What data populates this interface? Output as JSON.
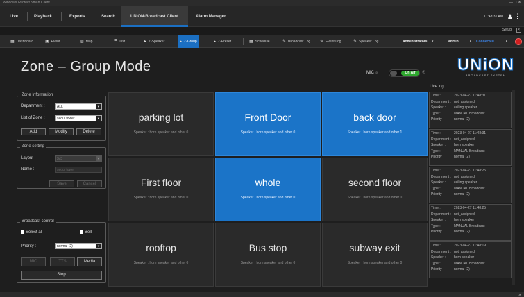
{
  "window": {
    "title": "Windows IProtect Smart Client",
    "controls": "—  □  ✕"
  },
  "menu": {
    "items": [
      "Live",
      "Playback",
      "Exports",
      "Search",
      "UNION-Broadcast Client",
      "Alarm Manager"
    ],
    "clock": "11:48:31 AM",
    "setup": "Setup"
  },
  "toolbar": {
    "items": [
      "Dashboard",
      "Event",
      "Map",
      "List",
      "Z-Speaker",
      "Z-Group",
      "Z-Preset",
      "Schedule",
      "Broadcast Log",
      "Event Log",
      "Speaker Log"
    ],
    "user_role": "Administrators",
    "user_name": "admin",
    "status": "Connected",
    "sep": "/"
  },
  "page": {
    "title": "Zone – Group Mode",
    "mic_label": "MIC",
    "mic_sub": "⊘",
    "on_air": "On Air"
  },
  "logo": {
    "word": "UNiON",
    "tag": "BROADCAST SYSTEM"
  },
  "zone_info": {
    "title": "Zone Information",
    "department_label": "Department :",
    "department_value": "ALL",
    "list_label": "List of Zone :",
    "list_value": "seoul tower",
    "add": "Add",
    "modify": "Modify",
    "delete": "Delete"
  },
  "zone_setting": {
    "title": "Zone setting",
    "layout_label": "Layout :",
    "layout_value": "3x3",
    "name_label": "Name :",
    "name_value": "seoul tower",
    "save": "Save",
    "cancel": "Cancel"
  },
  "broadcast": {
    "title": "Broadcast control",
    "select_all": "Select all",
    "bell": "Bell",
    "priority_label": "Priority :",
    "priority_value": "normal (2)",
    "mic": "MIC",
    "tts": "TTS",
    "media": "Media",
    "stop": "Stop"
  },
  "zones": [
    {
      "name": "parking lot",
      "speakers": "Speaker : horn speaker and other 0",
      "selected": false
    },
    {
      "name": "Front Door",
      "speakers": "Speaker : horn speaker and other 0",
      "selected": true
    },
    {
      "name": "back door",
      "speakers": "Speaker : horn speaker and other 1",
      "selected": true
    },
    {
      "name": "First floor",
      "speakers": "Speaker : horn speaker and other 0",
      "selected": false
    },
    {
      "name": "whole",
      "speakers": "Speaker : horn speaker and other 0",
      "selected": true
    },
    {
      "name": "second floor",
      "speakers": "Speaker : horn speaker and other 0",
      "selected": false
    },
    {
      "name": "rooftop",
      "speakers": "Speaker : horn speaker and other 0",
      "selected": false
    },
    {
      "name": "Bus stop",
      "speakers": "Speaker : horn speaker and other 0",
      "selected": false
    },
    {
      "name": "subway exit",
      "speakers": "Speaker : horn speaker and other 0",
      "selected": false
    }
  ],
  "live_log": {
    "title": "Live log",
    "labels": {
      "time": "Time :",
      "department": "Department :",
      "speaker": "Speaker :",
      "type": "Type :",
      "priority": "Priority :"
    },
    "entries": [
      {
        "time": "2023-04-27 11:48:31",
        "department": "not_assigned",
        "speaker": "ceiling speaker",
        "type": "MANUAL Broadcast",
        "priority": "normal (2)"
      },
      {
        "time": "2023-04-27 11:48:31",
        "department": "not_assigned",
        "speaker": "horn speaker",
        "type": "MANUAL Broadcast",
        "priority": "normal (2)"
      },
      {
        "time": "2023-04-27 11:48:25",
        "department": "not_assigned",
        "speaker": "ceiling speaker",
        "type": "MANUAL Broadcast",
        "priority": "normal (2)"
      },
      {
        "time": "2023-04-27 11:48:25",
        "department": "not_assigned",
        "speaker": "horn speaker",
        "type": "MANUAL Broadcast",
        "priority": "normal (2)"
      },
      {
        "time": "2023-04-27 11:48:19",
        "department": "not_assigned",
        "speaker": "horn speaker",
        "type": "MANUAL Broadcast",
        "priority": "normal (2)"
      }
    ]
  },
  "colors": {
    "accent": "#1b74c8",
    "on_air": "#2fa82f",
    "status_dot": "#d32020"
  }
}
